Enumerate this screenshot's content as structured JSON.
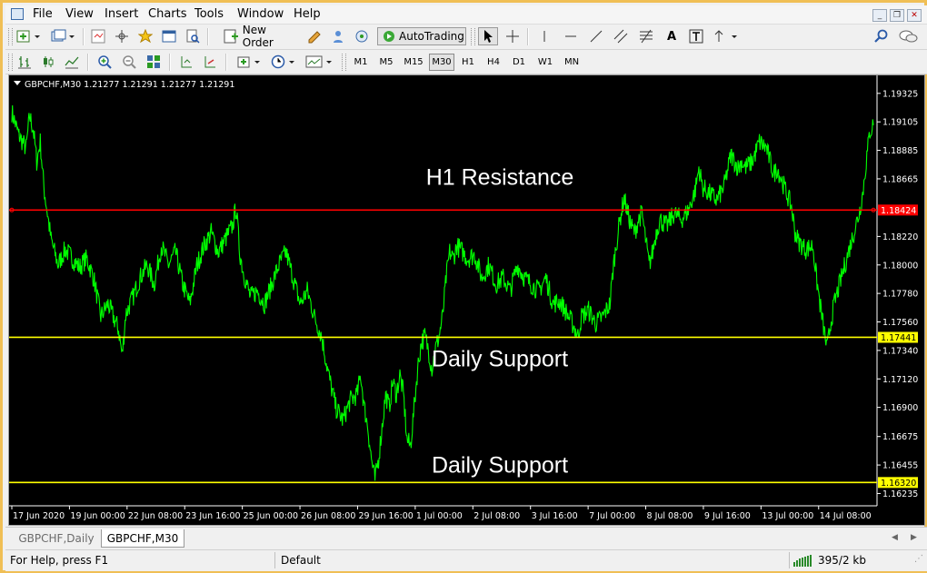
{
  "menu": [
    "File",
    "View",
    "Insert",
    "Charts",
    "Tools",
    "Window",
    "Help"
  ],
  "toolbar": {
    "new_order_label": "New Order",
    "autotrading_label": "AutoTrading",
    "text_tool_label": "A"
  },
  "timeframes": [
    "M1",
    "M5",
    "M15",
    "M30",
    "H1",
    "H4",
    "D1",
    "W1",
    "MN"
  ],
  "active_timeframe": "M30",
  "tabs": [
    {
      "label": "GBPCHF,Daily",
      "active": false
    },
    {
      "label": "GBPCHF,M30",
      "active": true
    }
  ],
  "status": {
    "help": "For Help, press F1",
    "profile": "Default",
    "traffic": "395/2 kb"
  },
  "chart_data": {
    "type": "line",
    "header": "GBPCHF,M30  1.21277 1.21291 1.21277 1.21291",
    "symbol": "GBPCHF",
    "timeframe": "M30",
    "background": "#000000",
    "series_color": "#00ff00",
    "ylim": [
      1.1614,
      1.1945
    ],
    "y_ticks": [
      "1.19325",
      "1.19105",
      "1.18885",
      "1.18665",
      "1.18220",
      "1.18000",
      "1.17780",
      "1.17560",
      "1.17340",
      "1.17120",
      "1.16900",
      "1.16675",
      "1.16455",
      "1.16235"
    ],
    "x_ticks": [
      "17 Jun 2020",
      "19 Jun 00:00",
      "22 Jun 08:00",
      "23 Jun 16:00",
      "25 Jun 00:00",
      "26 Jun 08:00",
      "29 Jun 16:00",
      "1 Jul 00:00",
      "2 Jul 08:00",
      "3 Jul 16:00",
      "7 Jul 00:00",
      "8 Jul 08:00",
      "9 Jul 16:00",
      "13 Jul 00:00",
      "14 Jul 08:00"
    ],
    "levels": [
      {
        "value": 1.18424,
        "label": "1.18424",
        "color": "#ff0000",
        "annotation": "H1 Resistance"
      },
      {
        "value": 1.17441,
        "label": "1.17441",
        "color": "#ffff00",
        "annotation": "Daily Support"
      },
      {
        "value": 1.1632,
        "label": "1.16320",
        "color": "#ffff00",
        "annotation": "Daily Support"
      }
    ],
    "price_path": [
      [
        0,
        1.1918
      ],
      [
        2,
        1.19
      ],
      [
        4,
        1.189
      ],
      [
        5,
        1.1915
      ],
      [
        6,
        1.1905
      ],
      [
        7,
        1.188
      ],
      [
        8,
        1.1895
      ],
      [
        9,
        1.186
      ],
      [
        10,
        1.184
      ],
      [
        11,
        1.182
      ],
      [
        13,
        1.18
      ],
      [
        15,
        1.1812
      ],
      [
        17,
        1.1805
      ],
      [
        19,
        1.1798
      ],
      [
        21,
        1.1805
      ],
      [
        23,
        1.179
      ],
      [
        25,
        1.176
      ],
      [
        27,
        1.177
      ],
      [
        30,
        1.175
      ],
      [
        31,
        1.173
      ],
      [
        32,
        1.1762
      ],
      [
        34,
        1.1775
      ],
      [
        36,
        1.179
      ],
      [
        38,
        1.18
      ],
      [
        40,
        1.1785
      ],
      [
        42,
        1.1815
      ],
      [
        44,
        1.18
      ],
      [
        46,
        1.181
      ],
      [
        48,
        1.1785
      ],
      [
        50,
        1.177
      ],
      [
        52,
        1.18
      ],
      [
        54,
        1.1815
      ],
      [
        56,
        1.1825
      ],
      [
        58,
        1.181
      ],
      [
        60,
        1.182
      ],
      [
        62,
        1.183
      ],
      [
        63,
        1.1845
      ],
      [
        64,
        1.181
      ],
      [
        65,
        1.1795
      ],
      [
        67,
        1.1775
      ],
      [
        69,
        1.178
      ],
      [
        71,
        1.177
      ],
      [
        73,
        1.1785
      ],
      [
        75,
        1.18
      ],
      [
        77,
        1.181
      ],
      [
        79,
        1.179
      ],
      [
        81,
        1.177
      ],
      [
        83,
        1.178
      ],
      [
        85,
        1.176
      ],
      [
        87,
        1.1745
      ],
      [
        89,
        1.1715
      ],
      [
        91,
        1.169
      ],
      [
        93,
        1.168
      ],
      [
        95,
        1.1695
      ],
      [
        97,
        1.17
      ],
      [
        98,
        1.1715
      ],
      [
        99,
        1.169
      ],
      [
        100,
        1.1675
      ],
      [
        101,
        1.165
      ],
      [
        102,
        1.1634
      ],
      [
        103,
        1.165
      ],
      [
        104,
        1.1675
      ],
      [
        105,
        1.17
      ],
      [
        106,
        1.169
      ],
      [
        107,
        1.171
      ],
      [
        108,
        1.17
      ],
      [
        109,
        1.1715
      ],
      [
        110,
        1.17
      ],
      [
        111,
        1.1665
      ],
      [
        112,
        1.166
      ],
      [
        113,
        1.169
      ],
      [
        114,
        1.172
      ],
      [
        115,
        1.174
      ],
      [
        116,
        1.1745
      ],
      [
        117,
        1.1735
      ],
      [
        118,
        1.172
      ],
      [
        119,
        1.1735
      ],
      [
        120,
        1.1745
      ],
      [
        121,
        1.176
      ],
      [
        122,
        1.179
      ],
      [
        123,
        1.181
      ],
      [
        124,
        1.1805
      ],
      [
        125,
        1.1815
      ],
      [
        126,
        1.1812
      ],
      [
        128,
        1.1805
      ],
      [
        130,
        1.1808
      ],
      [
        132,
        1.179
      ],
      [
        134,
        1.18
      ],
      [
        136,
        1.1785
      ],
      [
        138,
        1.179
      ],
      [
        140,
        1.178
      ],
      [
        142,
        1.18
      ],
      [
        144,
        1.179
      ],
      [
        146,
        1.1785
      ],
      [
        148,
        1.178
      ],
      [
        150,
        1.179
      ],
      [
        152,
        1.177
      ],
      [
        154,
        1.1772
      ],
      [
        156,
        1.1762
      ],
      [
        158,
        1.1752
      ],
      [
        159,
        1.1745
      ],
      [
        160,
        1.176
      ],
      [
        162,
        1.1765
      ],
      [
        164,
        1.1755
      ],
      [
        166,
        1.176
      ],
      [
        168,
        1.177
      ],
      [
        169,
        1.18
      ],
      [
        170,
        1.182
      ],
      [
        171,
        1.1838
      ],
      [
        172,
        1.1852
      ],
      [
        173,
        1.184
      ],
      [
        174,
        1.183
      ],
      [
        175,
        1.1825
      ],
      [
        176,
        1.1835
      ],
      [
        177,
        1.184
      ],
      [
        178,
        1.182
      ],
      [
        179,
        1.18
      ],
      [
        180,
        1.181
      ],
      [
        181,
        1.1825
      ],
      [
        182,
        1.1835
      ],
      [
        184,
        1.183
      ],
      [
        186,
        1.184
      ],
      [
        188,
        1.1835
      ],
      [
        190,
        1.1842
      ],
      [
        192,
        1.1858
      ],
      [
        193,
        1.1875
      ],
      [
        194,
        1.186
      ],
      [
        196,
        1.1855
      ],
      [
        198,
        1.185
      ],
      [
        200,
        1.186
      ],
      [
        202,
        1.1885
      ],
      [
        204,
        1.1875
      ],
      [
        205,
        1.188
      ],
      [
        206,
        1.1875
      ],
      [
        208,
        1.188
      ],
      [
        210,
        1.1895
      ],
      [
        212,
        1.189
      ],
      [
        213,
        1.188
      ],
      [
        214,
        1.187
      ],
      [
        215,
        1.1875
      ],
      [
        217,
        1.186
      ],
      [
        219,
        1.1845
      ],
      [
        220,
        1.1825
      ],
      [
        221,
        1.1818
      ],
      [
        223,
        1.1812
      ],
      [
        225,
        1.1815
      ],
      [
        226,
        1.179
      ],
      [
        227,
        1.177
      ],
      [
        228,
        1.1752
      ],
      [
        229,
        1.1735
      ],
      [
        230,
        1.1755
      ],
      [
        231,
        1.177
      ],
      [
        232,
        1.178
      ],
      [
        233,
        1.179
      ],
      [
        234,
        1.18
      ],
      [
        235,
        1.181
      ],
      [
        236,
        1.182
      ],
      [
        237,
        1.183
      ],
      [
        238,
        1.184
      ],
      [
        239,
        1.1855
      ],
      [
        240,
        1.188
      ],
      [
        241,
        1.1903
      ],
      [
        242,
        1.1908
      ]
    ]
  }
}
